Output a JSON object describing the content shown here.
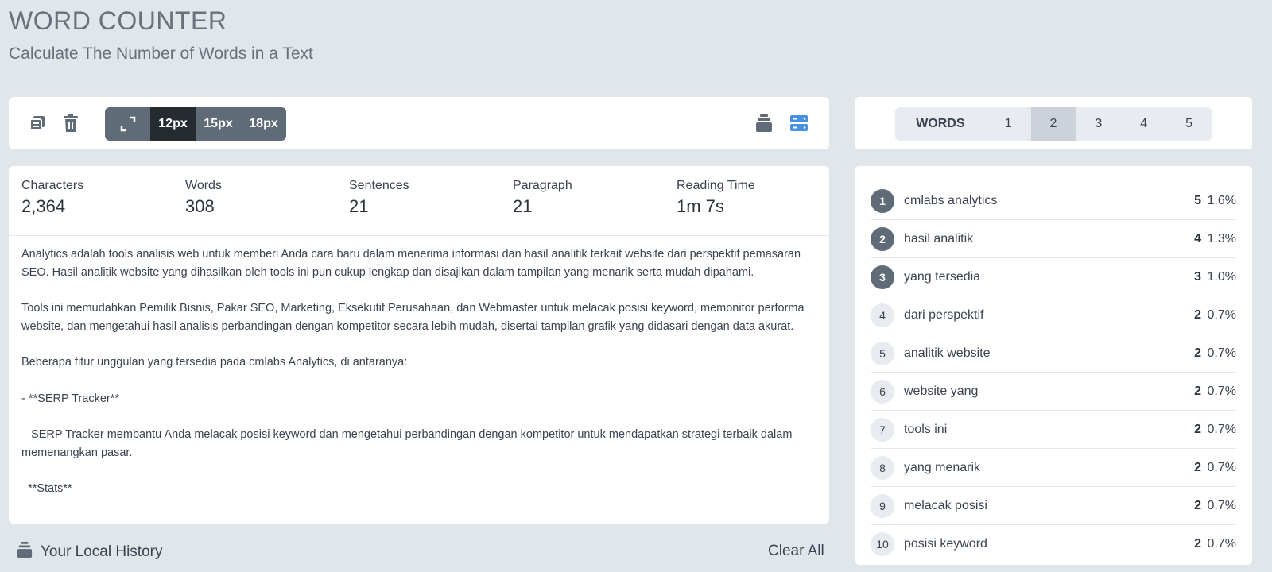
{
  "header": {
    "title": "WORD COUNTER",
    "subtitle": "Calculate The Number of Words in a Text"
  },
  "toolbar": {
    "copy_icon": "copy-icon",
    "delete_icon": "trash-icon",
    "expand_icon": "expand-icon",
    "font_sizes": [
      "12px",
      "15px",
      "18px"
    ],
    "active_font_size": "12px",
    "history_icon": "archive-icon",
    "storage_icon": "server-icon",
    "accent_color": "#4a90e2"
  },
  "stats": [
    {
      "label": "Characters",
      "value": "2,364"
    },
    {
      "label": "Words",
      "value": "308"
    },
    {
      "label": "Sentences",
      "value": "21"
    },
    {
      "label": "Paragraph",
      "value": "21"
    },
    {
      "label": "Reading Time",
      "value": "1m 7s"
    }
  ],
  "text": {
    "paragraphs": [
      "Analytics adalah tools analisis web untuk memberi Anda cara baru dalam menerima informasi dan hasil analitik terkait website dari perspektif pemasaran SEO. Hasil analitik website yang dihasilkan oleh tools ini pun cukup lengkap dan disajikan dalam tampilan yang menarik serta mudah dipahami.",
      "Tools ini memudahkan Pemilik Bisnis, Pakar SEO, Marketing, Eksekutif Perusahaan, dan Webmaster untuk melacak posisi keyword, memonitor performa website, dan mengetahui hasil analisis perbandingan dengan kompetitor secara lebih mudah, disertai tampilan grafik yang didasari dengan data akurat.",
      "Beberapa fitur unggulan yang tersedia pada cmlabs Analytics, di antaranya:",
      "- **SERP Tracker**",
      "   SERP Tracker membantu Anda melacak posisi keyword dan mengetahui perbandingan dengan kompetitor untuk mendapatkan strategi terbaik dalam memenangkan pasar.",
      "  **Stats**"
    ]
  },
  "history": {
    "label": "Your Local History",
    "clear_label": "Clear All"
  },
  "ngram": {
    "tabs": [
      "WORDS",
      "1",
      "2",
      "3",
      "4",
      "5"
    ],
    "active_tab": "2"
  },
  "keywords": [
    {
      "rank": "1",
      "phrase": "cmlabs analytics",
      "count": "5",
      "pct": "1.6%"
    },
    {
      "rank": "2",
      "phrase": "hasil analitik",
      "count": "4",
      "pct": "1.3%"
    },
    {
      "rank": "3",
      "phrase": "yang tersedia",
      "count": "3",
      "pct": "1.0%"
    },
    {
      "rank": "4",
      "phrase": "dari perspektif",
      "count": "2",
      "pct": "0.7%"
    },
    {
      "rank": "5",
      "phrase": "analitik website",
      "count": "2",
      "pct": "0.7%"
    },
    {
      "rank": "6",
      "phrase": "website yang",
      "count": "2",
      "pct": "0.7%"
    },
    {
      "rank": "7",
      "phrase": "tools ini",
      "count": "2",
      "pct": "0.7%"
    },
    {
      "rank": "8",
      "phrase": "yang menarik",
      "count": "2",
      "pct": "0.7%"
    },
    {
      "rank": "9",
      "phrase": "melacak posisi",
      "count": "2",
      "pct": "0.7%"
    },
    {
      "rank": "10",
      "phrase": "posisi keyword",
      "count": "2",
      "pct": "0.7%"
    }
  ]
}
